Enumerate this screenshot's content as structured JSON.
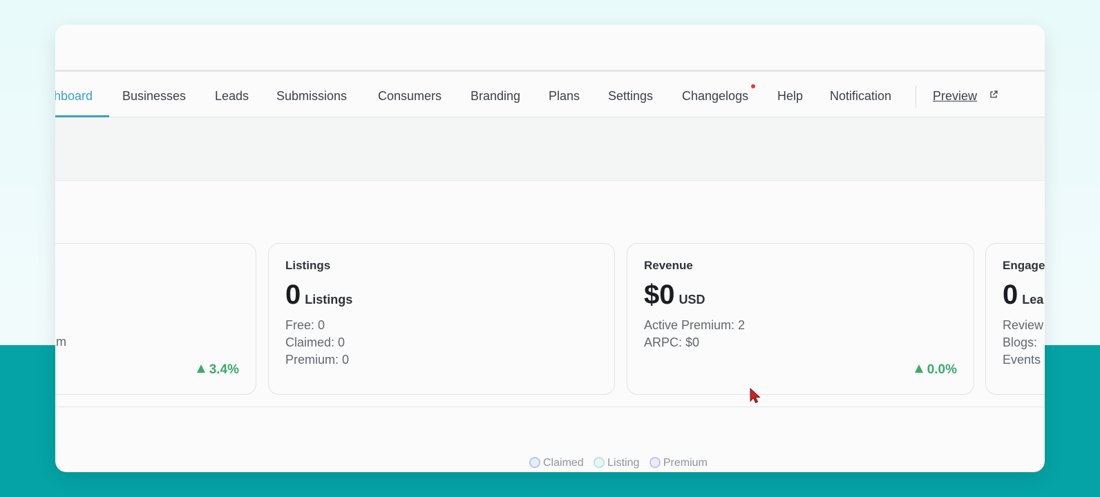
{
  "nav": {
    "items": [
      "hboard",
      "Businesses",
      "Leads",
      "Submissions",
      "Consumers",
      "Branding",
      "Plans",
      "Settings",
      "Changelogs",
      "Help",
      "Notification"
    ],
    "active_index": 0,
    "preview_label": "Preview"
  },
  "cards": {
    "first": {
      "partial_text": "m",
      "trend": "3.4%"
    },
    "listings": {
      "title": "Listings",
      "value": "0",
      "unit": "Listings",
      "stats": [
        "Free: 0",
        "Claimed: 0",
        "Premium: 0"
      ]
    },
    "revenue": {
      "title": "Revenue",
      "value": "$0",
      "unit": "USD",
      "stats": [
        "Active Premium: 2",
        "ARPC: $0"
      ],
      "trend": "0.0%"
    },
    "engagement": {
      "title": "Engage",
      "value": "0",
      "unit": "Lea",
      "stats": [
        "Review",
        "Blogs:",
        "Events"
      ]
    }
  },
  "legend": {
    "items": [
      {
        "label": "Claimed",
        "color": "#b7c6e6"
      },
      {
        "label": "Listing",
        "color": "#b9e4ea"
      },
      {
        "label": "Premium",
        "color": "#c9c0e8"
      }
    ]
  },
  "colors": {
    "accent": "#3a9fc8",
    "positive": "#3bab6b",
    "notification_dot": "#e53935",
    "teal_background": "#05a3a6"
  }
}
